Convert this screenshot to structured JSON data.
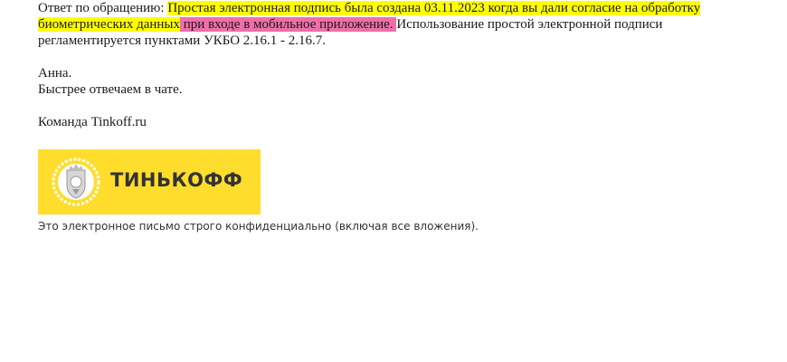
{
  "email": {
    "reply_prefix": "Ответ по обращению: ",
    "highlight_yellow": "Простая электронная подпись была создана 03.11.2023 когда вы дали согласие на обработку биометрических данных",
    "highlight_pink": " при входе в мобильное приложение. ",
    "rest_text": "Использование простой электронной подписи регламентируется пунктами УКБО 2.16.1 - 2.16.7.",
    "signature_name": "Анна.",
    "signature_note": "Быстрее отвечаем в чате.",
    "team_line": "Команда Tinkoff.ru"
  },
  "logo": {
    "text": "ТИНЬКОФФ",
    "background_color": "#ffdd2d",
    "emblem_icon": "tinkoff-coat-of-arms-icon"
  },
  "footer": {
    "disclaimer": "Это электронное письмо строго конфиденциально (включая все вложения)."
  },
  "colors": {
    "highlight_yellow": "#ffff00",
    "highlight_pink": "#f06ea9"
  }
}
